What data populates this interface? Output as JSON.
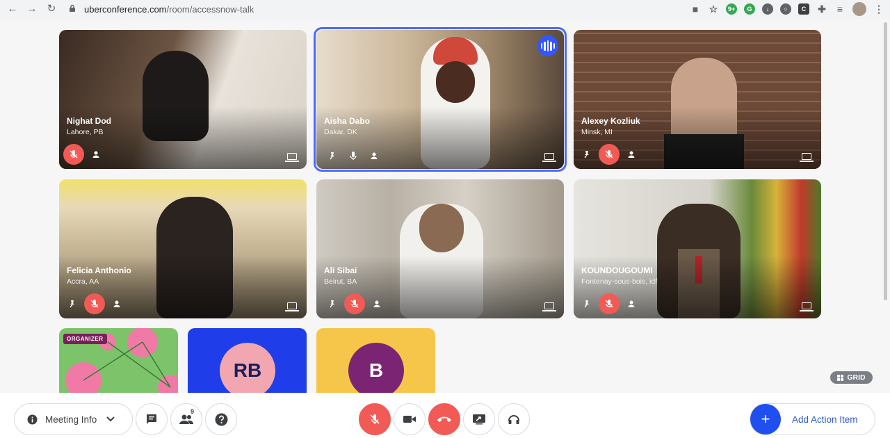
{
  "browser": {
    "url_host": "uberconference.com",
    "url_path": "/room/accessnow-talk",
    "ext_badge": "9+"
  },
  "colors": {
    "muted_red": "#f25a55",
    "active_blue": "#4b69ff",
    "accent_blue": "#1f4ff0"
  },
  "participants": [
    {
      "name": "Nighat Dod",
      "location": "Lahore, PB",
      "muted": true,
      "bg": "#5b4638"
    },
    {
      "name": "Aisha Dabo",
      "location": "Dakar, DK",
      "muted": false,
      "active_speaker": true,
      "bg": "#8a7a63"
    },
    {
      "name": "Alexey Kozliuk",
      "location": "Minsk, MI",
      "muted": true,
      "bg": "#6a4a3a"
    },
    {
      "name": "Felicia Anthonio",
      "location": "Accra, AA",
      "muted": true,
      "bg": "#a8987a"
    },
    {
      "name": "Ali Sibai",
      "location": "Beirut, BA",
      "muted": true,
      "bg": "#b6aea4"
    },
    {
      "name": "KOUNDOUGOUMI",
      "location": "Fontenay-sous-bois, idf",
      "muted": true,
      "bg": "#c9c7c0"
    }
  ],
  "audio_participants": [
    {
      "badge": "ORGANIZER",
      "initials": "",
      "tile_color": "#7cc36a",
      "avatar_color": ""
    },
    {
      "badge": "",
      "initials": "RB",
      "tile_color": "#1f3de8",
      "avatar_color": "#f2a7b0",
      "text_color": "#1a1f5e"
    },
    {
      "badge": "",
      "initials": "B",
      "tile_color": "#f5c64a",
      "avatar_color": "#7b2474",
      "text_color": "#ffffff"
    }
  ],
  "view_toggle": "GRID",
  "toolbar": {
    "meeting_info": "Meeting Info",
    "participants_count": "9",
    "add_action_item": "Add Action Item"
  }
}
